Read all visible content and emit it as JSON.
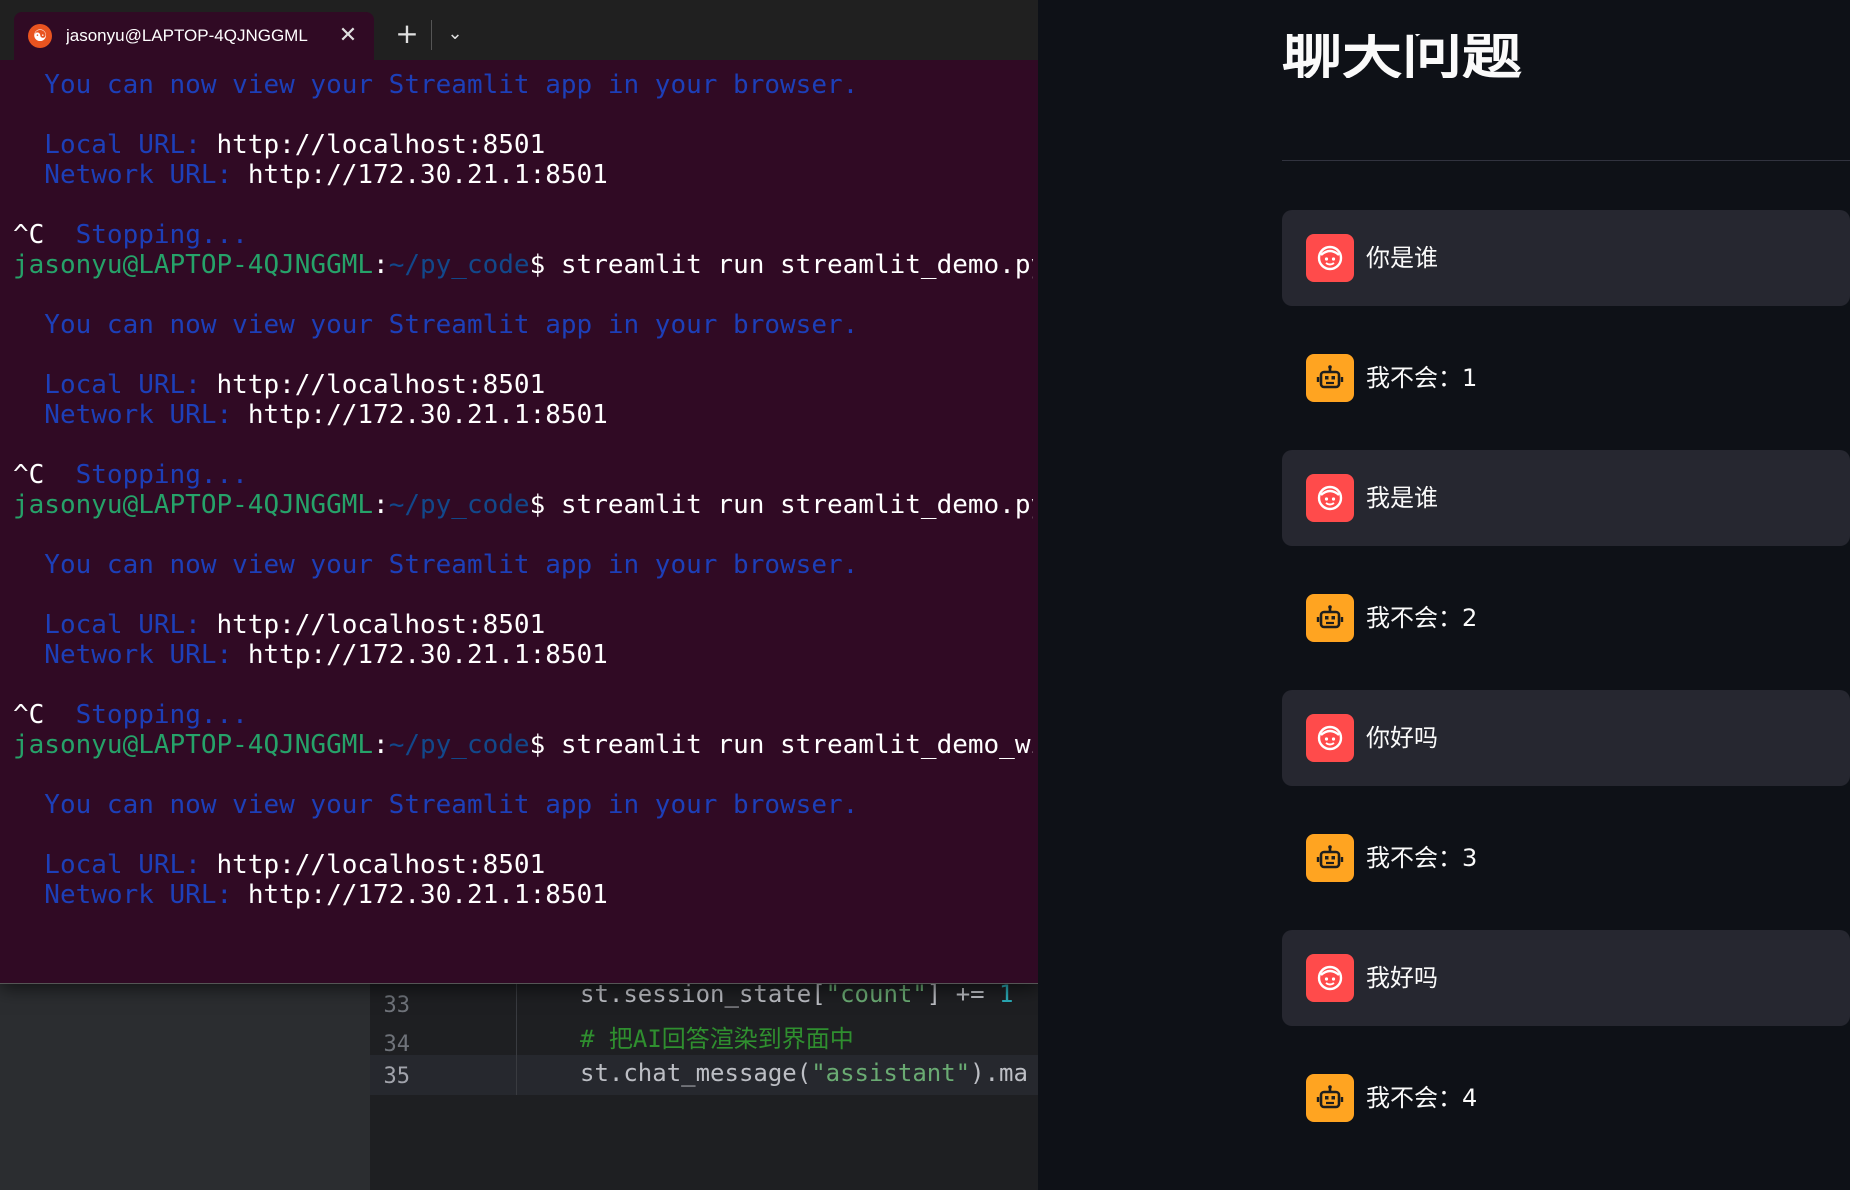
{
  "terminal": {
    "tab_title": "jasonyu@LAPTOP-4QJNGGML",
    "tab_close_glyph": "✕",
    "new_tab_glyph": "+",
    "dropdown_glyph": "⌄",
    "lines": [
      {
        "kind": "info",
        "text": "  You can now view your Streamlit app in your browser."
      },
      {
        "kind": "blank",
        "text": ""
      },
      {
        "kind": "url",
        "label": "  Local URL: ",
        "value": "http://localhost:8501"
      },
      {
        "kind": "url",
        "label": "  Network URL: ",
        "value": "http://172.30.21.1:8501"
      },
      {
        "kind": "blank",
        "text": ""
      },
      {
        "kind": "stop",
        "prefix": "^C",
        "text": "  Stopping..."
      },
      {
        "kind": "prompt",
        "user": "jasonyu@LAPTOP-4QJNGGML",
        "path": "~/py_code",
        "cmd": "$ streamlit run streamlit_demo.py"
      },
      {
        "kind": "blank",
        "text": ""
      },
      {
        "kind": "info",
        "text": "  You can now view your Streamlit app in your browser."
      },
      {
        "kind": "blank",
        "text": ""
      },
      {
        "kind": "url",
        "label": "  Local URL: ",
        "value": "http://localhost:8501"
      },
      {
        "kind": "url",
        "label": "  Network URL: ",
        "value": "http://172.30.21.1:8501"
      },
      {
        "kind": "blank",
        "text": ""
      },
      {
        "kind": "stop",
        "prefix": "^C",
        "text": "  Stopping..."
      },
      {
        "kind": "prompt",
        "user": "jasonyu@LAPTOP-4QJNGGML",
        "path": "~/py_code",
        "cmd": "$ streamlit run streamlit_demo.py"
      },
      {
        "kind": "blank",
        "text": ""
      },
      {
        "kind": "info",
        "text": "  You can now view your Streamlit app in your browser."
      },
      {
        "kind": "blank",
        "text": ""
      },
      {
        "kind": "url",
        "label": "  Local URL: ",
        "value": "http://localhost:8501"
      },
      {
        "kind": "url",
        "label": "  Network URL: ",
        "value": "http://172.30.21.1:8501"
      },
      {
        "kind": "blank",
        "text": ""
      },
      {
        "kind": "stop",
        "prefix": "^C",
        "text": "  Stopping..."
      },
      {
        "kind": "prompt",
        "user": "jasonyu@LAPTOP-4QJNGGML",
        "path": "~/py_code",
        "cmd": "$ streamlit run streamlit_demo_with_"
      },
      {
        "kind": "blank",
        "text": ""
      },
      {
        "kind": "info",
        "text": "  You can now view your Streamlit app in your browser."
      },
      {
        "kind": "blank",
        "text": ""
      },
      {
        "kind": "url",
        "label": "  Local URL: ",
        "value": "http://localhost:8501"
      },
      {
        "kind": "url",
        "label": "  Network URL: ",
        "value": "http://172.30.21.1:8501"
      }
    ]
  },
  "editor": {
    "line_numbers": [
      "33",
      "34",
      "35"
    ],
    "code": {
      "l33_pre": "st.session_state[",
      "l33_str": "\"count\"",
      "l33_mid": "] += ",
      "l33_num": "1",
      "l34_cmt": "# 把AI回答渲染到界面中",
      "l35_pre": "st.chat_message(",
      "l35_str": "\"assistant\"",
      "l35_post": ").ma"
    }
  },
  "chat": {
    "heading": "聊天问题",
    "messages": [
      {
        "role": "user",
        "text": "你是谁"
      },
      {
        "role": "assistant",
        "text": "我不会：1"
      },
      {
        "role": "user",
        "text": "我是谁"
      },
      {
        "role": "assistant",
        "text": "我不会：2"
      },
      {
        "role": "user",
        "text": "你好吗"
      },
      {
        "role": "assistant",
        "text": "我不会：3"
      },
      {
        "role": "user",
        "text": "我好吗"
      },
      {
        "role": "assistant",
        "text": "我不会：4"
      }
    ],
    "colors": {
      "user_avatar": "#ff4b4b",
      "assistant_avatar": "#ffa421",
      "user_bubble": "#262730"
    }
  }
}
